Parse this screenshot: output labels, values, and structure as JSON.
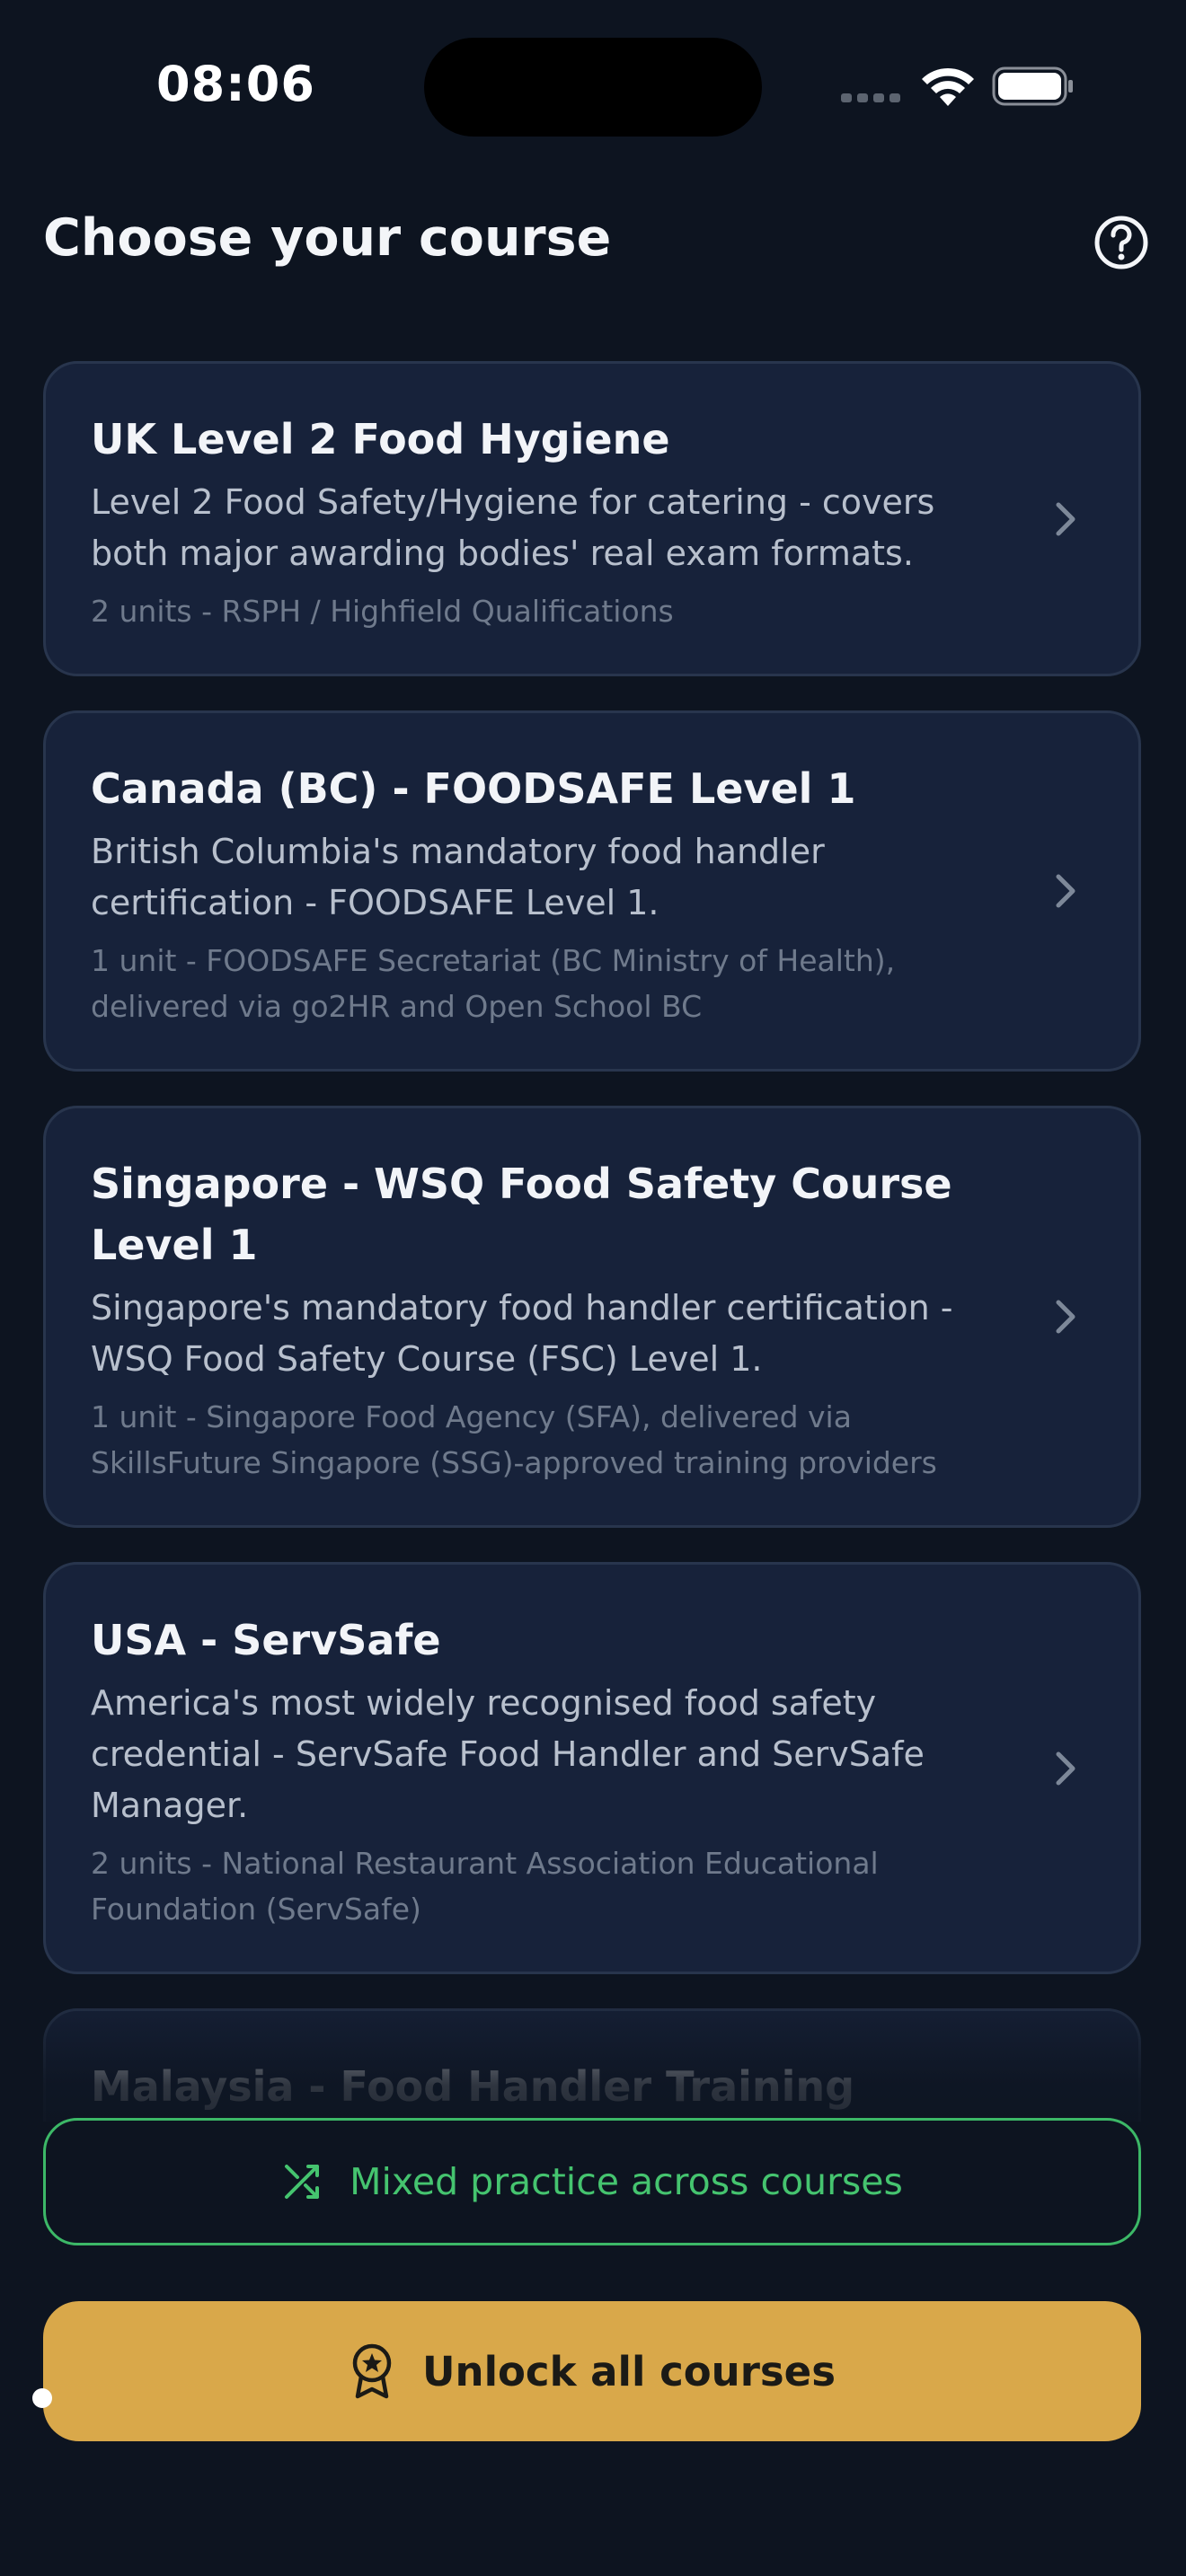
{
  "status_bar": {
    "time": "08:06"
  },
  "header": {
    "title": "Choose your course"
  },
  "courses": [
    {
      "title": "UK Level 2 Food Hygiene",
      "description": "Level 2 Food Safety/Hygiene for catering - covers both major awarding bodies' real exam formats.",
      "meta": "2 units - RSPH / Highfield Qualifications"
    },
    {
      "title": "Canada (BC) - FOODSAFE Level 1",
      "description": "British Columbia's mandatory food handler certification - FOODSAFE Level 1.",
      "meta": "1 unit - FOODSAFE Secretariat (BC Ministry of Health), delivered via go2HR and Open School BC"
    },
    {
      "title": "Singapore - WSQ Food Safety Course Level 1",
      "description": "Singapore's mandatory food handler certification - WSQ Food Safety Course (FSC) Level 1.",
      "meta": "1 unit - Singapore Food Agency (SFA), delivered via SkillsFuture Singapore (SSG)-approved training providers"
    },
    {
      "title": "USA - ServSafe",
      "description": "America's most widely recognised food safety credential - ServSafe Food Handler and ServSafe Manager.",
      "meta": "2 units - National Restaurant Association Educational Foundation (ServSafe)"
    },
    {
      "title": "Malaysia - Food Handler Training",
      "description": "",
      "meta": ""
    }
  ],
  "actions": {
    "mixed_label": "Mixed practice across courses",
    "unlock_label": "Unlock all courses"
  },
  "colors": {
    "background": "#0d1420",
    "card": "#17223a",
    "accent_green": "#45c46f",
    "accent_gold": "#d9a84a"
  },
  "icons": {
    "help": "help-circle-icon",
    "chevron": "chevron-right-icon",
    "mixed": "shuffle-icon",
    "unlock": "award-icon"
  }
}
